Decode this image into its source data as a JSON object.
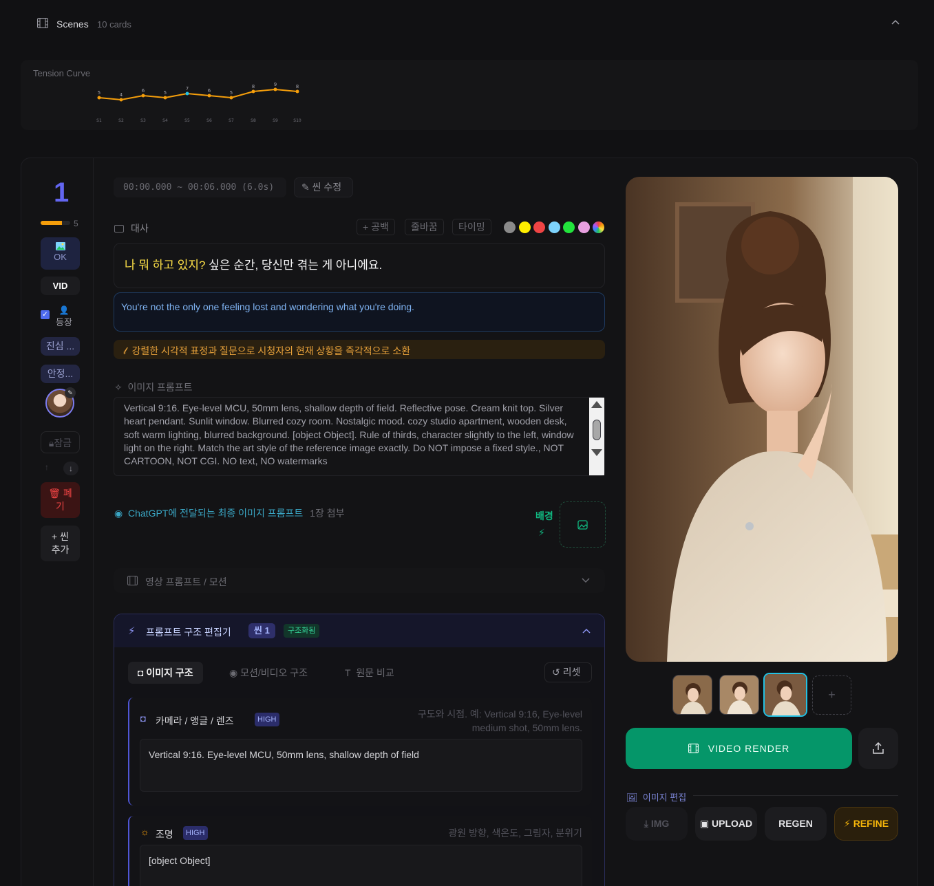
{
  "header": {
    "title": "Scenes",
    "count": "10 cards"
  },
  "tension": {
    "label": "Tension Curve",
    "chart_data": {
      "type": "line",
      "categories": [
        "S1",
        "S2",
        "S3",
        "S4",
        "S5",
        "S6",
        "S7",
        "S8",
        "S9",
        "S10"
      ],
      "values": [
        5,
        4,
        6,
        5,
        7,
        6,
        5,
        8,
        9,
        8
      ],
      "highlight_index": 4,
      "line_color": "#f59e0b",
      "highlight_color": "#22c1e4",
      "title": "Tension Curve"
    }
  },
  "scene": {
    "number": "1",
    "progress": {
      "value": 5,
      "max": 7,
      "label": "5"
    },
    "ok_label": "OK",
    "vid_label": "VID",
    "appear_label": "등장",
    "appear_checked": true,
    "tag1": "진심 ...",
    "tag2": "안정...",
    "lock_label": "잠금",
    "delete_label_1": "폐",
    "delete_label_2": "기",
    "add_label_1": "+ 씬",
    "add_label_2": "추가"
  },
  "timeline": {
    "timecode": "00:00.000 ~ 00:06.000 (6.0s)",
    "edit_label": "씬 수정"
  },
  "dialogue": {
    "label": "대사",
    "space_btn": "+ 공백",
    "linebreak_btn": "줄바꿈",
    "timing_btn": "타이밍",
    "colors": [
      "#8a8a8a",
      "#ffee00",
      "#ef4444",
      "#7dd3fc",
      "#22e33c",
      "#e8a0e0"
    ],
    "highlight_text": "나 뭐 하고 있지?",
    "rest_text": " 싶은 순간, 당신만 겪는 게 아니에요.",
    "english": "You're not the only one feeling lost and wondering what you're doing.",
    "hook": "강렬한 시각적 표정과 질문으로 시청자의 현재 상황을 즉각적으로 소환"
  },
  "image_prompt": {
    "label": "이미지 프롬프트",
    "text": "Vertical 9:16. Eye-level MCU, 50mm lens, shallow depth of field. Reflective pose. Cream knit top. Silver heart pendant. Sunlit window. Blurred cozy room. Nostalgic mood. cozy studio apartment, wooden desk, soft warm lighting, blurred background. [object Object]. Rule of thirds, character slightly to the left, window light on the right. Match the art style of the reference image exactly. Do NOT impose a fixed style., NOT CARTOON, NOT CGI. NO text, NO watermarks",
    "final_label": "ChatGPT에 전달되는 최종 이미지 프롬프트",
    "attach": "1장 첨부",
    "bg_label": "배경"
  },
  "video_prompt": {
    "label": "영상 프롬프트 / 모션"
  },
  "structure_editor": {
    "title": "프롬프트 구조 편집기",
    "scene_badge": "씬 1",
    "status_badge": "구조화됨",
    "tabs": [
      "이미지 구조",
      "모션/비디오 구조",
      "원문 비교"
    ],
    "reset_label": "리셋",
    "fields": [
      {
        "name": "카메라 / 앵글 / 렌즈",
        "priority": "HIGH",
        "hint_1": "구도와 시점. 예: Vertical 9:16, Eye-level",
        "hint_2": "medium shot, 50mm lens.",
        "value": "Vertical 9:16. Eye-level MCU, 50mm lens, shallow depth of field"
      },
      {
        "name": "조명",
        "priority": "HIGH",
        "hint_1": "광원 방향, 색온도, 그림자, 분위기",
        "value": "[object Object]"
      }
    ]
  },
  "right_panel": {
    "render_label": "VIDEO RENDER",
    "image_edit_label": "이미지 편집",
    "actions": [
      "IMG",
      "UPLOAD",
      "REGEN",
      "REFINE"
    ],
    "add_thumb": "+"
  }
}
